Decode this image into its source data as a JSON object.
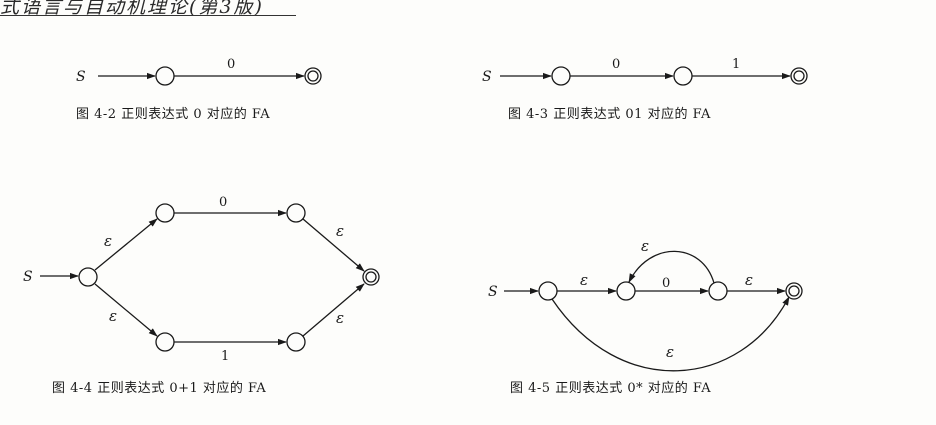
{
  "header": {
    "text": "式语言与自动机理论(第3版)"
  },
  "figures": [
    {
      "start": "S",
      "edges": [
        "0"
      ],
      "caption": "图 4-2 正则表达式 0 对应的 FA"
    },
    {
      "start": "S",
      "edges": [
        "0",
        "1"
      ],
      "caption": "图 4-3 正则表达式 01 对应的 FA"
    },
    {
      "start": "S",
      "edges": [
        "0",
        "1",
        "ε",
        "ε",
        "ε",
        "ε"
      ],
      "caption": "图 4-4 正则表达式 0+1 对应的 FA"
    },
    {
      "start": "S",
      "edges": [
        "ε",
        "0",
        "ε",
        "ε",
        "ε"
      ],
      "caption": "图 4-5 正则表达式 0* 对应的 FA"
    }
  ]
}
